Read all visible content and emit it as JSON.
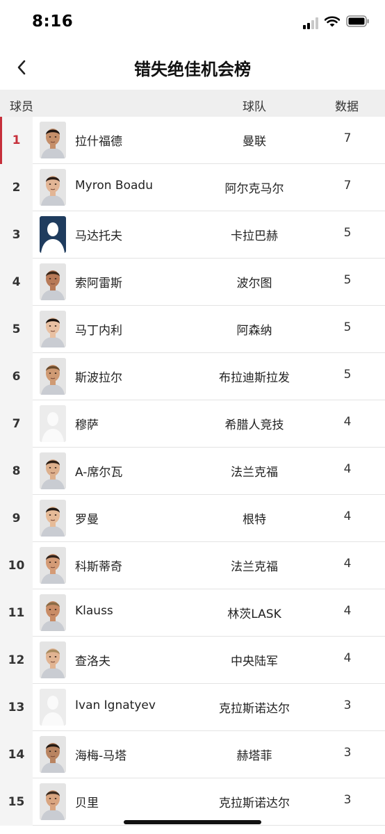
{
  "status_bar": {
    "time": "8:16"
  },
  "header": {
    "title": "错失绝佳机会榜"
  },
  "table": {
    "columns": {
      "player": "球员",
      "team": "球队",
      "data": "数据"
    },
    "rows": [
      {
        "rank": "1",
        "player": "拉什福德",
        "team": "曼联",
        "value": "7",
        "avatar": "photo"
      },
      {
        "rank": "2",
        "player": "Myron Boadu",
        "team": "阿尔克马尔",
        "value": "7",
        "avatar": "photo"
      },
      {
        "rank": "3",
        "player": "马达托夫",
        "team": "卡拉巴赫",
        "value": "5",
        "avatar": "silhouette-dark"
      },
      {
        "rank": "4",
        "player": "索阿雷斯",
        "team": "波尔图",
        "value": "5",
        "avatar": "photo"
      },
      {
        "rank": "5",
        "player": "马丁内利",
        "team": "阿森纳",
        "value": "5",
        "avatar": "photo"
      },
      {
        "rank": "6",
        "player": "斯波拉尔",
        "team": "布拉迪斯拉发",
        "value": "5",
        "avatar": "photo"
      },
      {
        "rank": "7",
        "player": "穆萨",
        "team": "希腊人竞技",
        "value": "4",
        "avatar": "silhouette-light"
      },
      {
        "rank": "8",
        "player": "A-席尔瓦",
        "team": "法兰克福",
        "value": "4",
        "avatar": "photo"
      },
      {
        "rank": "9",
        "player": "罗曼",
        "team": "根特",
        "value": "4",
        "avatar": "photo"
      },
      {
        "rank": "10",
        "player": "科斯蒂奇",
        "team": "法兰克福",
        "value": "4",
        "avatar": "photo"
      },
      {
        "rank": "11",
        "player": "Klauss",
        "team": "林茨LASK",
        "value": "4",
        "avatar": "photo"
      },
      {
        "rank": "12",
        "player": "查洛夫",
        "team": "中央陆军",
        "value": "4",
        "avatar": "photo"
      },
      {
        "rank": "13",
        "player": "Ivan Ignatyev",
        "team": "克拉斯诺达尔",
        "value": "3",
        "avatar": "silhouette-light"
      },
      {
        "rank": "14",
        "player": "海梅-马塔",
        "team": "赫塔菲",
        "value": "3",
        "avatar": "photo"
      },
      {
        "rank": "15",
        "player": "贝里",
        "team": "克拉斯诺达尔",
        "value": "3",
        "avatar": "photo"
      }
    ]
  },
  "colors": {
    "accent": "#c62f3a",
    "header_bg": "#efefef",
    "rank_bg": "#f4f4f4"
  }
}
